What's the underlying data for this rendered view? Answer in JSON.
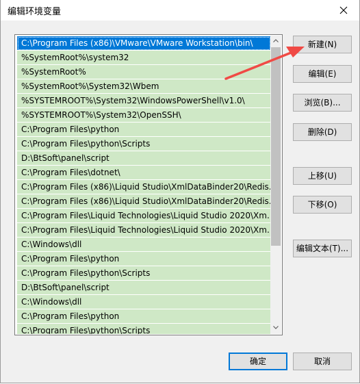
{
  "window": {
    "title": "编辑环境变量"
  },
  "list": {
    "items": [
      "C:\\Program Files (x86)\\VMware\\VMware Workstation\\bin\\",
      "%SystemRoot%\\system32",
      "%SystemRoot%",
      "%SystemRoot%\\System32\\Wbem",
      "%SYSTEMROOT%\\System32\\WindowsPowerShell\\v1.0\\",
      "%SYSTEMROOT%\\System32\\OpenSSH\\",
      "C:\\Program Files\\python",
      "C:\\Program Files\\python\\Scripts",
      "D:\\BtSoft\\panel\\script",
      "C:\\Program Files\\dotnet\\",
      "C:\\Program Files (x86)\\Liquid Studio\\XmlDataBinder20\\Redis...",
      "C:\\Program Files (x86)\\Liquid Studio\\XmlDataBinder20\\Redis...",
      "C:\\Program Files\\Liquid Technologies\\Liquid Studio 2020\\Xm...",
      "C:\\Program Files\\Liquid Technologies\\Liquid Studio 2020\\Xm...",
      "C:\\Windows\\dll",
      "C:\\Program Files\\python",
      "C:\\Program Files\\python\\Scripts",
      "D:\\BtSoft\\panel\\script",
      "C:\\Windows\\dll",
      "C:\\Program Files\\python",
      "C:\\Program Files\\python\\Scripts"
    ],
    "selected_index": 0
  },
  "buttons": {
    "new": "新建(N)",
    "edit": "编辑(E)",
    "browse": "浏览(B)...",
    "delete": "删除(D)",
    "move_up": "上移(U)",
    "move_down": "下移(O)",
    "edit_text": "编辑文本(T)...",
    "ok": "确定",
    "cancel": "取消"
  },
  "colors": {
    "selected_bg": "#0078d7",
    "item_bg": "#cfe8c6",
    "annotation_arrow": "#f04a45"
  }
}
